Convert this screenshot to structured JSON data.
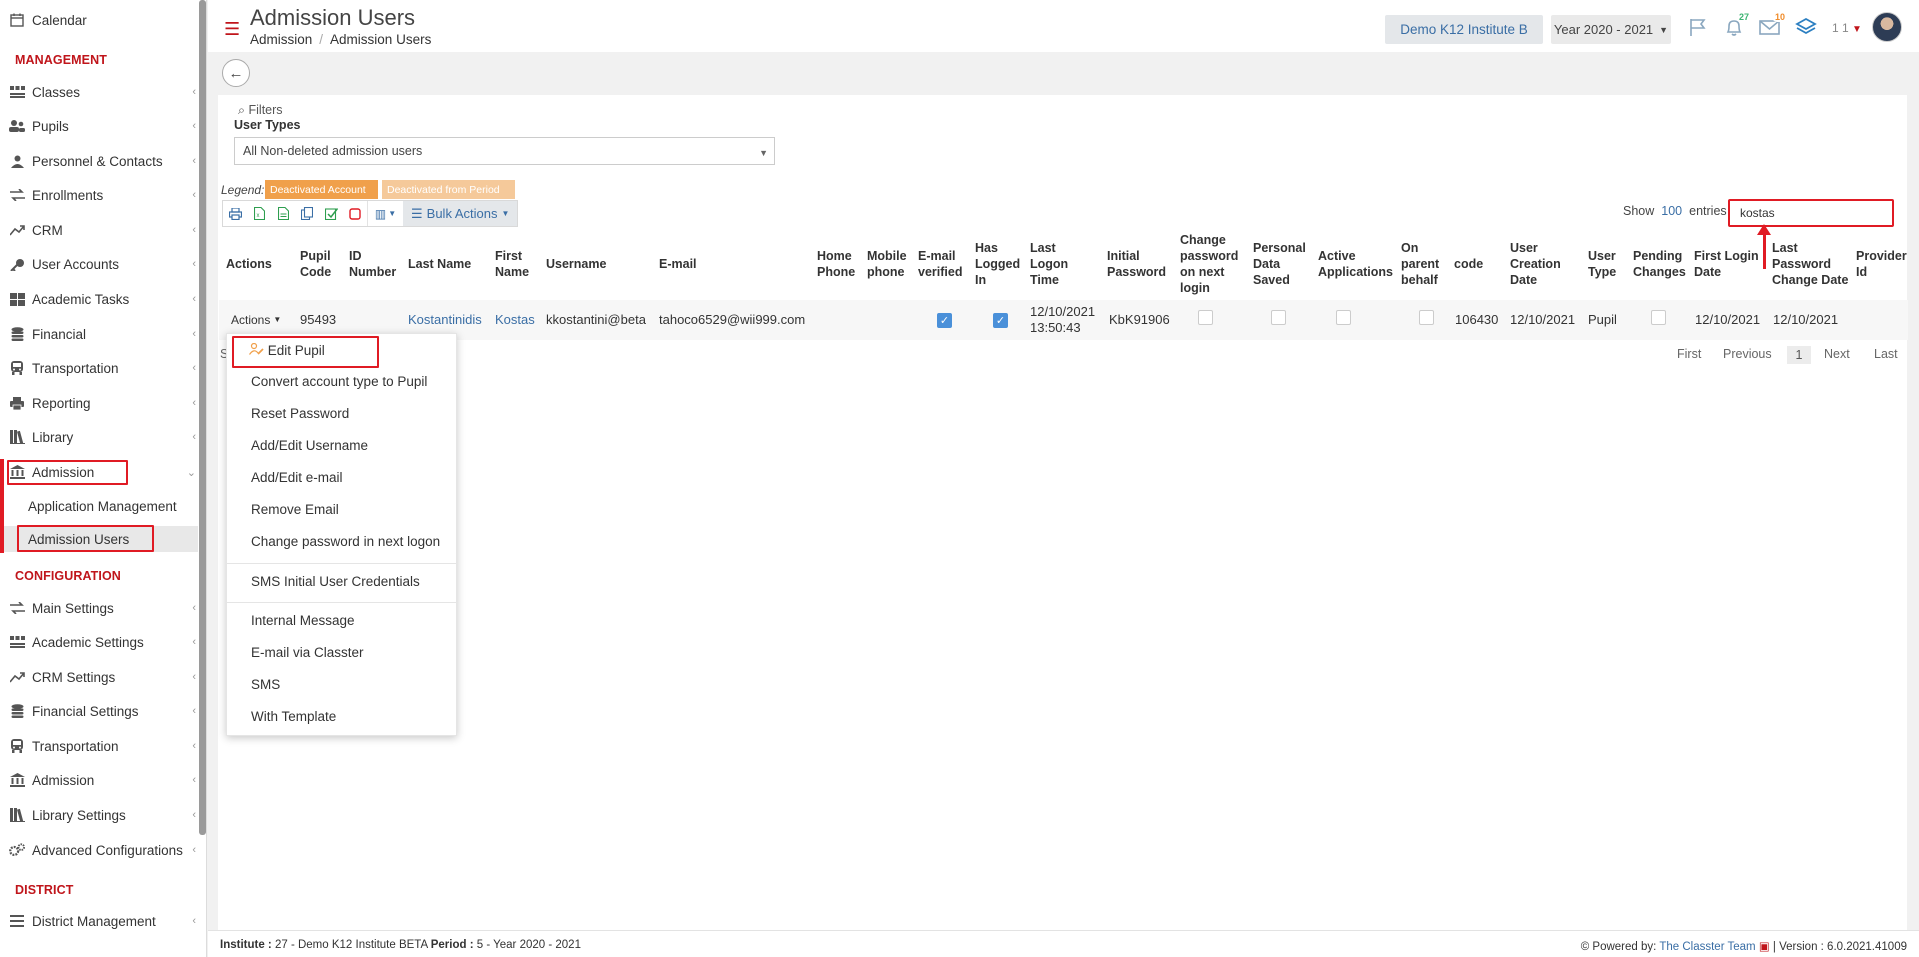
{
  "sidebar": {
    "items_top": [
      {
        "label": "Calendar",
        "icon": "calendar-icon"
      }
    ],
    "section_management": "MANAGEMENT",
    "management_items": [
      {
        "label": "Classes",
        "icon": "classes-icon"
      },
      {
        "label": "Pupils",
        "icon": "pupils-icon"
      },
      {
        "label": "Personnel & Contacts",
        "icon": "personnel-icon"
      },
      {
        "label": "Enrollments",
        "icon": "enrollments-icon"
      },
      {
        "label": "CRM",
        "icon": "crm-icon"
      },
      {
        "label": "User Accounts",
        "icon": "key-icon"
      },
      {
        "label": "Academic Tasks",
        "icon": "tasks-icon"
      },
      {
        "label": "Financial",
        "icon": "coins-icon"
      },
      {
        "label": "Transportation",
        "icon": "bus-icon"
      },
      {
        "label": "Reporting",
        "icon": "printer-icon"
      },
      {
        "label": "Library",
        "icon": "books-icon"
      },
      {
        "label": "Admission",
        "icon": "bank-icon"
      }
    ],
    "admission_sub": [
      {
        "label": "Application Management"
      },
      {
        "label": "Admission Users"
      }
    ],
    "section_configuration": "CONFIGURATION",
    "configuration_items": [
      {
        "label": "Main Settings",
        "icon": "settings-icon"
      },
      {
        "label": "Academic Settings",
        "icon": "classes-icon"
      },
      {
        "label": "CRM Settings",
        "icon": "crm-icon"
      },
      {
        "label": "Financial Settings",
        "icon": "coins-icon"
      },
      {
        "label": "Transportation",
        "icon": "bus-icon"
      },
      {
        "label": "Admission",
        "icon": "bank-icon"
      },
      {
        "label": "Library Settings",
        "icon": "books-icon"
      },
      {
        "label": "Advanced Configurations",
        "icon": "gears-icon"
      }
    ],
    "section_district": "DISTRICT",
    "district_items": [
      {
        "label": "District Management",
        "icon": "list-icon"
      }
    ]
  },
  "header": {
    "title": "Admission Users",
    "breadcrumb": [
      "Admission",
      "Admission Users"
    ],
    "institute_button": "Demo K12 Institute B",
    "year_select": "Year 2020 - 2021",
    "notifications_badge": "27",
    "messages_badge": "10",
    "user_number": "1 1"
  },
  "filters": {
    "title": "Filters",
    "user_types_label": "User Types",
    "user_types_value": "All Non-deleted admission users"
  },
  "legend": {
    "label": "Legend:",
    "deactivated_account": "Deactivated Account",
    "deactivated_from_period": "Deactivated from Period",
    "colors": {
      "deactivated_account": "#f0a04b",
      "deactivated_from_period": "#f5c99a"
    }
  },
  "toolbar": {
    "bulk_actions": "Bulk Actions"
  },
  "table_controls": {
    "show_label": "Show",
    "entries_value": "100",
    "entries_label": "entries",
    "search_value": "kostas"
  },
  "table": {
    "columns": [
      "Actions",
      "Pupil Code",
      "ID Number",
      "Last Name",
      "First Name",
      "Username",
      "E-mail",
      "Home Phone",
      "Mobile phone",
      "E-mail verified",
      "Has Logged In",
      "Last Logon Time",
      "Initial Password",
      "Change password on next login",
      "Personal Data Saved",
      "Active Applications",
      "On parent behalf",
      "code",
      "User Creation Date",
      "User Type",
      "Pending Changes",
      "First Login Date",
      "Last Password Change Date",
      "Provider Id"
    ],
    "row": {
      "actions": "Actions",
      "pupil_code": "95493",
      "last_name": "Kostantinidis",
      "first_name": "Kostas",
      "username": "kkostantini@beta",
      "email": "tahoco6529@wii999.com",
      "last_logon": "12/10/2021 13:50:43",
      "initial_password": "KbK91906",
      "code": "106430",
      "creation_date": "12/10/2021",
      "user_type": "Pupil",
      "first_login": "12/10/2021",
      "last_pw_change": "12/10/2021"
    },
    "row_hidden_text": "S"
  },
  "pagination": {
    "first": "First",
    "previous": "Previous",
    "current": "1",
    "next": "Next",
    "last": "Last"
  },
  "actions_menu": {
    "items_group1": [
      "Edit Pupil",
      "Convert account type to Pupil",
      "Reset Password",
      "Add/Edit Username",
      "Add/Edit e-mail",
      "Remove Email",
      "Change password in next logon"
    ],
    "items_group2": [
      "SMS Initial User Credentials"
    ],
    "items_group3": [
      "Internal Message",
      "E-mail via Classter",
      "SMS",
      "With Template"
    ]
  },
  "footer": {
    "institute_label": "Institute :",
    "institute_value": "27 - Demo K12 Institute BETA",
    "period_label": "Period :",
    "period_value": "5 - Year 2020 - 2021",
    "powered_by": "Powered by:",
    "team": "The Classter Team",
    "version": "| Version : 6.0.2021.41009"
  },
  "colors": {
    "accent_red": "#c0151b",
    "link_blue": "#3a6ea5",
    "annotation_red": "#e01b24"
  }
}
